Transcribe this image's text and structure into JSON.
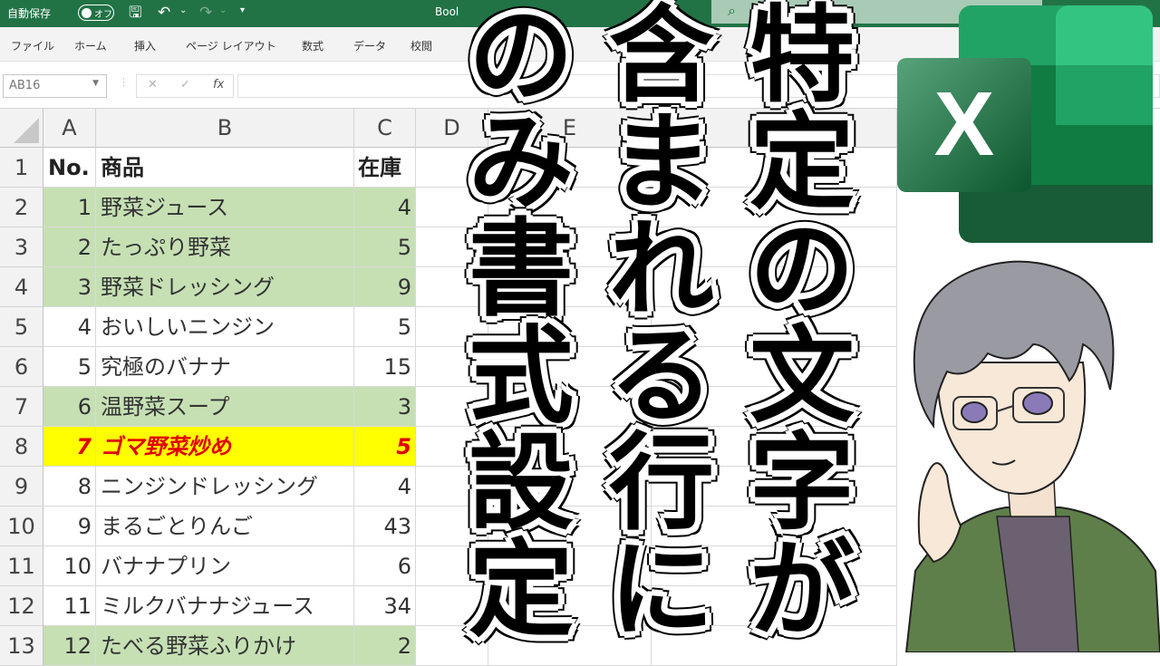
{
  "titlebar": {
    "autosave_label": "自動保存",
    "autosave_state": "オフ",
    "doc_title": "Bool",
    "accent_color": "#217346"
  },
  "ribbon": {
    "tabs": [
      "ファイル",
      "ホーム",
      "挿入",
      "ページ レイアウト",
      "数式",
      "データ",
      "校閲"
    ]
  },
  "formula_bar": {
    "name_box": "AB16",
    "fx": "fx",
    "cancel": "✕",
    "enter": "✓",
    "formula": ""
  },
  "columns": [
    "A",
    "B",
    "C",
    "D",
    "E"
  ],
  "header_row": {
    "row": "1",
    "no": "No.",
    "product": "商品",
    "stock": "在庫"
  },
  "rows": [
    {
      "row": "2",
      "no": "1",
      "product": "野菜ジュース",
      "stock": "4",
      "style": "green"
    },
    {
      "row": "3",
      "no": "2",
      "product": "たっぷり野菜",
      "stock": "5",
      "style": "green"
    },
    {
      "row": "4",
      "no": "3",
      "product": "野菜ドレッシング",
      "stock": "9",
      "style": "green"
    },
    {
      "row": "5",
      "no": "4",
      "product": "おいしいニンジン",
      "stock": "5",
      "style": ""
    },
    {
      "row": "6",
      "no": "5",
      "product": "究極のバナナ",
      "stock": "15",
      "style": ""
    },
    {
      "row": "7",
      "no": "6",
      "product": "温野菜スープ",
      "stock": "3",
      "style": "green"
    },
    {
      "row": "8",
      "no": "7",
      "product": "ゴマ野菜炒め",
      "stock": "5",
      "style": "yellow"
    },
    {
      "row": "9",
      "no": "8",
      "product": "ニンジンドレッシング",
      "stock": "4",
      "style": ""
    },
    {
      "row": "10",
      "no": "9",
      "product": "まるごとりんご",
      "stock": "43",
      "style": ""
    },
    {
      "row": "11",
      "no": "10",
      "product": "バナナプリン",
      "stock": "6",
      "style": ""
    },
    {
      "row": "12",
      "no": "11",
      "product": "ミルクバナナジュース",
      "stock": "34",
      "style": ""
    },
    {
      "row": "13",
      "no": "12",
      "product": "たべる野菜ふりかけ",
      "stock": "2",
      "style": "green"
    }
  ],
  "highlight_colors": {
    "green": "#c6e0b4",
    "yellow": "#ffff00",
    "red_text": "#e00000"
  },
  "overlay_title": {
    "line1": "特定の文字が",
    "line2": "含まれる行に",
    "line3": "のみ書式設定"
  },
  "logo": {
    "letter": "X",
    "icon": "excel-logo-icon"
  }
}
